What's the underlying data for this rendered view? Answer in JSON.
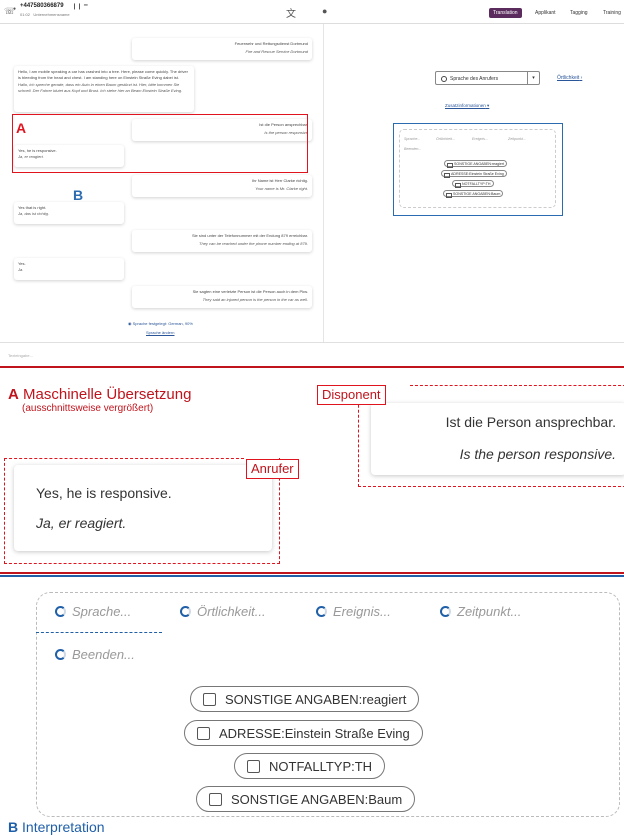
{
  "screenshot": {
    "caller": {
      "number": "+447580366879",
      "status_left": "01:02",
      "status_right": "Unternehmensname"
    },
    "toolbar_tabs": [
      {
        "label": "Translation",
        "active": true
      },
      {
        "label": "Applikant"
      },
      {
        "label": "Tagging"
      },
      {
        "label": "Training"
      }
    ],
    "messages": [
      {
        "side": "dispatcher",
        "lines": [
          "Feuerwehr und Rettungsdienst Dortmund",
          "Fire and Rescue Service Dortmund"
        ]
      },
      {
        "side": "caller",
        "lines": [
          "Hello, I am mobile speaking a car has crashed into a tree. Here, please come quickly. The driver is bleeding from the head and chest. I am standing here on Einstein Straße Eving dabei ist.",
          "Hallo, ich spreche gerade, dass ein Auto in einen Baum gestürzt ist. Hier, bitte kommen Sie schnell. Der Fahrer blutet aus Kopf und Brust. Ich stehe hier an Beam Einstein Straße Eving."
        ]
      },
      {
        "side": "dispatcher",
        "lines": [
          "Ist die Person ansprechbar.",
          "Is the person responsive"
        ]
      },
      {
        "side": "caller",
        "lines": [
          "Yes, he is responsive.",
          "Ja, er reagiert."
        ]
      },
      {
        "side": "dispatcher",
        "lines": [
          "Ihr Name ist Herr Clarke richtig.",
          "Your name is Mr. Clarke right."
        ]
      },
      {
        "side": "caller",
        "lines": [
          "Yes that is right.",
          "Ja, das ist richtig."
        ]
      },
      {
        "side": "dispatcher",
        "lines": [
          "Sie sind unter der Telefonnummer mit der Endung 879 erreichbar.",
          "They can be reached under the phone number ending at 879."
        ]
      },
      {
        "side": "caller",
        "lines": [
          "Yes.",
          "Ja."
        ]
      },
      {
        "side": "dispatcher",
        "lines": [
          "Sie sagten eine verletzte Person ist die Person auch in dem Pkw.",
          "They said an injured person is the person in the car as well."
        ]
      }
    ],
    "language_detected": "Sprache festgelegt: German, 90%",
    "more_link": "Sprache ändern",
    "input_placeholder": "Texteingabe...",
    "lang_select_label": "Sprache des Anrufers",
    "ort_link": "Örtlichkeit",
    "zusatz_link": "Zusatzinformationen",
    "mini_label_a": "A",
    "mini_label_b": "B"
  },
  "zoomA": {
    "letter": "A",
    "title": "Maschinelle Übersetzung",
    "subtitle": "(ausschnittsweise vergrößert)",
    "dispatcher_tag": "Disponent",
    "caller_tag": "Anrufer",
    "dispatcher_text": "Ist die Person ansprechbar.",
    "dispatcher_translation": "Is the person responsive.",
    "caller_text": "Yes, he is responsive.",
    "caller_translation": "Ja, er reagiert."
  },
  "zoomB": {
    "letter": "B",
    "title": "Interpretation",
    "steps": [
      "Sprache...",
      "Örtlichkeit...",
      "Ereignis...",
      "Zeitpunkt...",
      "Beenden..."
    ],
    "chips": [
      "SONSTIGE ANGABEN:reagiert",
      "ADRESSE:Einstein Straße Eving",
      "NOTFALLTYP:TH",
      "SONSTIGE ANGABEN:Baum"
    ]
  },
  "colors": {
    "red": "#e0141e",
    "blue": "#1f5fa8",
    "tab_active": "#5c2b5e"
  }
}
